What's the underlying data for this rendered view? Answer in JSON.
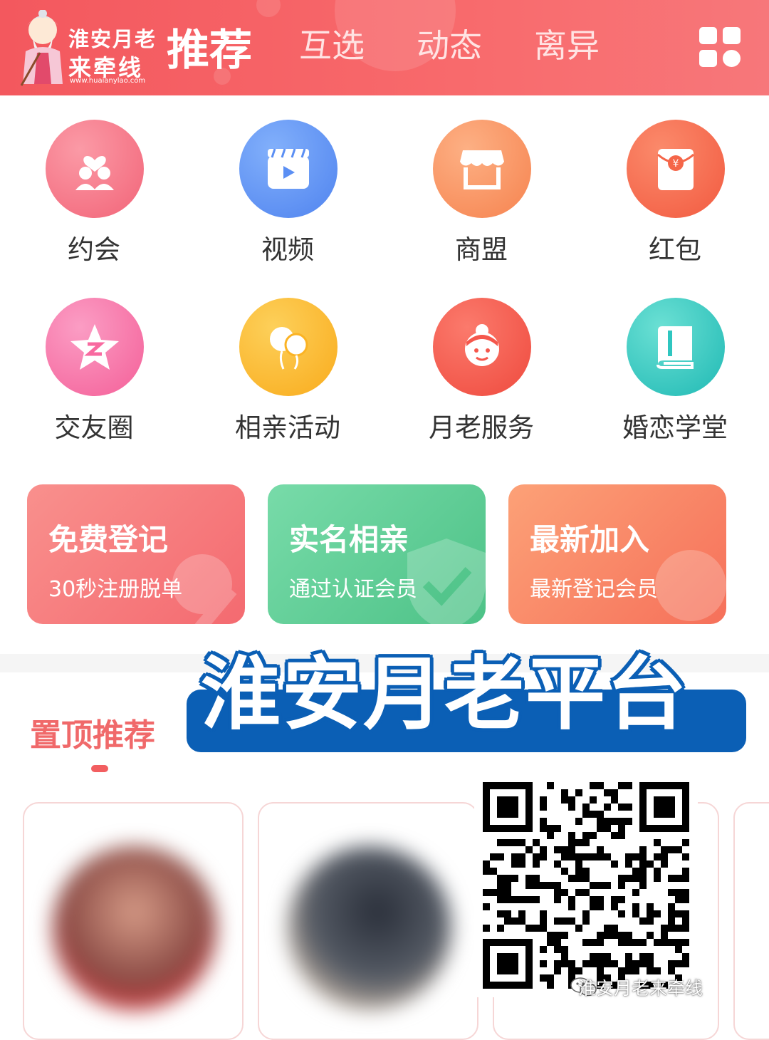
{
  "header": {
    "brand_line1": "淮安月老",
    "brand_line2": "来牵线",
    "brand_url": "www.huaianylao.com",
    "tabs": [
      {
        "label": "推荐",
        "active": true
      },
      {
        "label": "互选",
        "active": false
      },
      {
        "label": "动态",
        "active": false
      },
      {
        "label": "离异",
        "active": false
      }
    ],
    "menu_icon": "grid-icon"
  },
  "shortcuts": [
    {
      "label": "约会",
      "icon": "couple-heart-icon",
      "color": "#f6707f"
    },
    {
      "label": "视频",
      "icon": "video-clapper-icon",
      "color": "#5b8ff4"
    },
    {
      "label": "商盟",
      "icon": "store-icon",
      "color": "#f98d5a"
    },
    {
      "label": "红包",
      "icon": "red-envelope-icon",
      "color": "#f56649"
    },
    {
      "label": "交友圈",
      "icon": "star-circle-icon",
      "color": "#f86aa0"
    },
    {
      "label": "相亲活动",
      "icon": "balloons-icon",
      "color": "#fbb324"
    },
    {
      "label": "月老服务",
      "icon": "customer-service-icon",
      "color": "#f5574c"
    },
    {
      "label": "婚恋学堂",
      "icon": "book-icon",
      "color": "#2fc6c0"
    }
  ],
  "feature_cards": [
    {
      "title": "免费登记",
      "subtitle": "30秒注册脱单",
      "color": "#f6777a"
    },
    {
      "title": "实名相亲",
      "subtitle": "通过认证会员",
      "color": "#5ccb93"
    },
    {
      "title": "最新加入",
      "subtitle": "最新登记会员",
      "color": "#f98463"
    }
  ],
  "section": {
    "title": "置顶推荐"
  },
  "overlay": {
    "banner_text": "淮安月老平台",
    "watermark": "淮安月老来牵线"
  }
}
